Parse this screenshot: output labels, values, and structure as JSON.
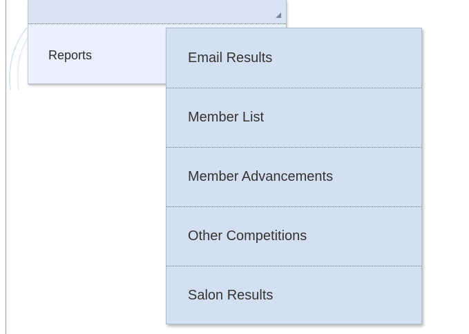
{
  "menu": {
    "reports_label": "Reports"
  },
  "submenu": {
    "items": [
      {
        "label": "Email Results"
      },
      {
        "label": "Member List"
      },
      {
        "label": "Member Advancements"
      },
      {
        "label": "Other Competitions"
      },
      {
        "label": "Salon Results"
      }
    ]
  },
  "icons": {
    "resize_grip": "resize-grip-icon"
  },
  "colors": {
    "submenu_bg": "#d3e0f1",
    "menu_bg": "#e8f1fd",
    "text": "#333333"
  }
}
